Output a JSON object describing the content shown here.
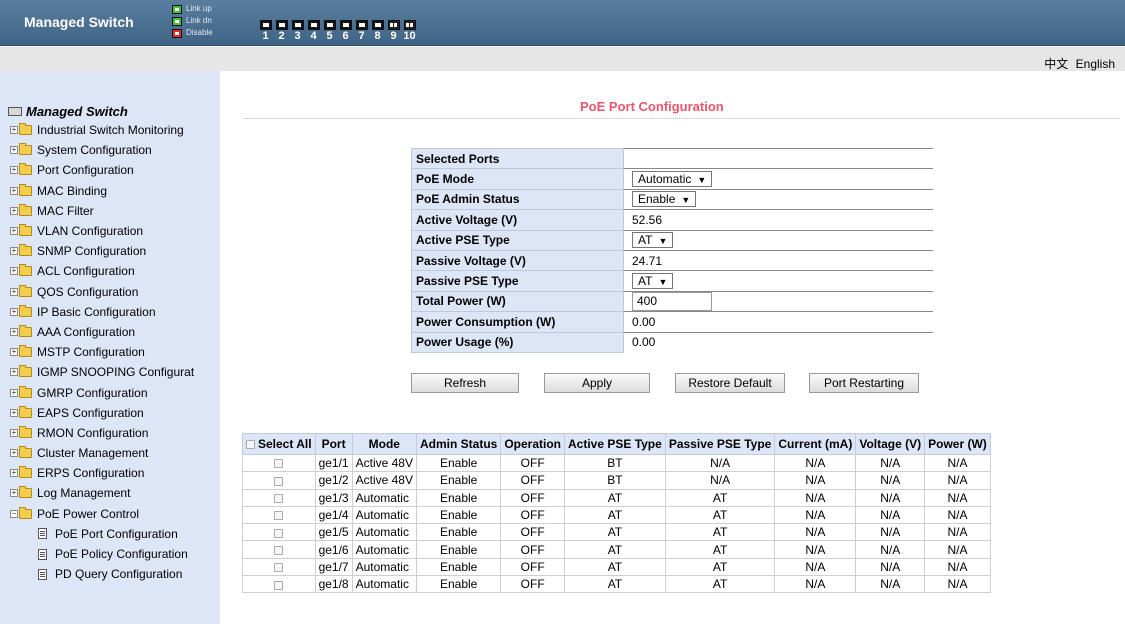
{
  "header": {
    "brand": "Managed Switch",
    "legend": [
      {
        "label": "Link up",
        "color": "#3ec43a"
      },
      {
        "label": "Link dn",
        "color": "#3ec43a"
      },
      {
        "label": "Disable",
        "color": "#e02b2b"
      }
    ],
    "ports": [
      "1",
      "2",
      "3",
      "4",
      "5",
      "6",
      "7",
      "8",
      "9",
      "10"
    ]
  },
  "lang": {
    "chinese": "中文",
    "english": "English"
  },
  "sidebar": {
    "root": "Managed Switch",
    "items": [
      "Industrial Switch Monitoring",
      "System Configuration",
      "Port Configuration",
      "MAC Binding",
      "MAC Filter",
      "VLAN Configuration",
      "SNMP Configuration",
      "ACL Configuration",
      "QOS Configuration",
      "IP Basic Configuration",
      "AAA Configuration",
      "MSTP Configuration",
      "IGMP SNOOPING Configurat",
      "GMRP Configuration",
      "EAPS Configuration",
      "RMON Configuration",
      "Cluster Management",
      "ERPS Configuration",
      "Log Management",
      "PoE Power Control"
    ],
    "subitems": [
      "PoE Port Configuration",
      "PoE Policy Configuration",
      "PD Query Configuration"
    ]
  },
  "page": {
    "title": "PoE Port Configuration"
  },
  "config": {
    "selected_ports": {
      "label": "Selected Ports",
      "value": ""
    },
    "poe_mode": {
      "label": "PoE Mode",
      "value": "Automatic"
    },
    "admin_status": {
      "label": "PoE Admin Status",
      "value": "Enable"
    },
    "active_voltage": {
      "label": "Active Voltage (V)",
      "value": "52.56"
    },
    "active_pse": {
      "label": "Active PSE Type",
      "value": "AT"
    },
    "passive_voltage": {
      "label": "Passive Voltage (V)",
      "value": "24.71"
    },
    "passive_pse": {
      "label": "Passive PSE Type",
      "value": "AT"
    },
    "total_power": {
      "label": "Total Power (W)",
      "value": "400"
    },
    "power_consumption": {
      "label": "Power Consumption (W)",
      "value": "0.00"
    },
    "power_usage": {
      "label": "Power Usage (%)",
      "value": "0.00"
    }
  },
  "buttons": {
    "refresh": "Refresh",
    "apply": "Apply",
    "restore": "Restore Default",
    "restart": "Port Restarting"
  },
  "table": {
    "headers": [
      "Select All",
      "Port",
      "Mode",
      "Admin Status",
      "Operation",
      "Active PSE Type",
      "Passive PSE Type",
      "Current (mA)",
      "Voltage (V)",
      "Power (W)"
    ],
    "rows": [
      [
        "ge1/1",
        "Active 48V",
        "Enable",
        "OFF",
        "BT",
        "N/A",
        "N/A",
        "N/A",
        "N/A"
      ],
      [
        "ge1/2",
        "Active 48V",
        "Enable",
        "OFF",
        "BT",
        "N/A",
        "N/A",
        "N/A",
        "N/A"
      ],
      [
        "ge1/3",
        "Automatic",
        "Enable",
        "OFF",
        "AT",
        "AT",
        "N/A",
        "N/A",
        "N/A"
      ],
      [
        "ge1/4",
        "Automatic",
        "Enable",
        "OFF",
        "AT",
        "AT",
        "N/A",
        "N/A",
        "N/A"
      ],
      [
        "ge1/5",
        "Automatic",
        "Enable",
        "OFF",
        "AT",
        "AT",
        "N/A",
        "N/A",
        "N/A"
      ],
      [
        "ge1/6",
        "Automatic",
        "Enable",
        "OFF",
        "AT",
        "AT",
        "N/A",
        "N/A",
        "N/A"
      ],
      [
        "ge1/7",
        "Automatic",
        "Enable",
        "OFF",
        "AT",
        "AT",
        "N/A",
        "N/A",
        "N/A"
      ],
      [
        "ge1/8",
        "Automatic",
        "Enable",
        "OFF",
        "AT",
        "AT",
        "N/A",
        "N/A",
        "N/A"
      ]
    ]
  }
}
